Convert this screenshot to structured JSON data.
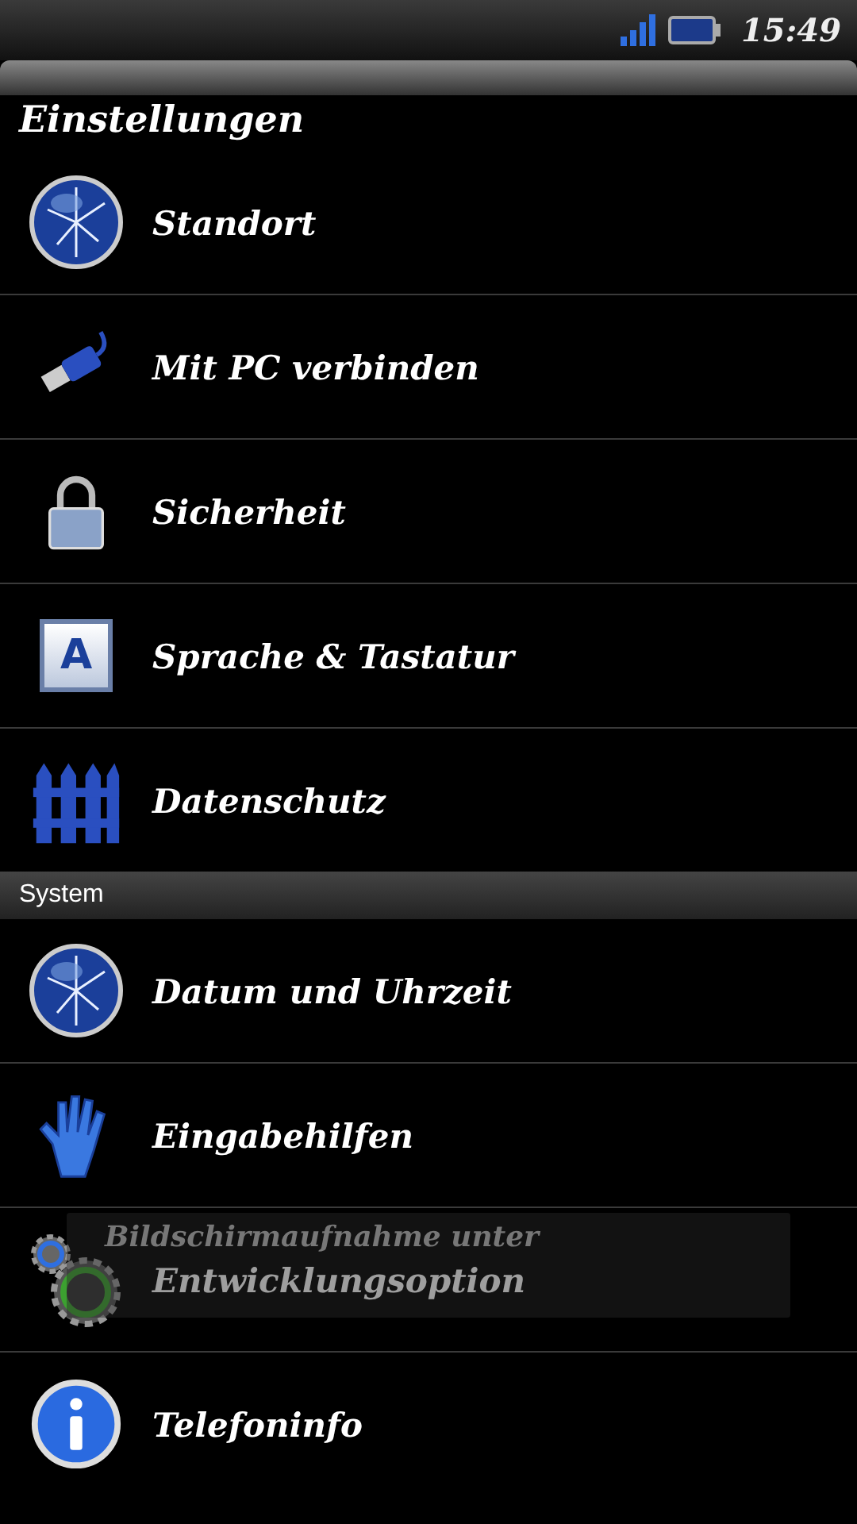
{
  "status_bar": {
    "time": "15:49"
  },
  "title": "Einstellungen",
  "groups": [
    {
      "items": [
        {
          "label": "Standort",
          "kind": "globe"
        },
        {
          "label": "Mit PC verbinden",
          "kind": "usb"
        },
        {
          "label": "Sicherheit",
          "kind": "lock"
        },
        {
          "label": "Sprache & Tastatur",
          "kind": "key",
          "key_letter": "A"
        },
        {
          "label": "Datenschutz",
          "kind": "fence"
        }
      ]
    },
    {
      "header": "System",
      "items": [
        {
          "label": "Datum und Uhrzeit",
          "kind": "globe"
        },
        {
          "label": "Eingabehilfen",
          "kind": "hand"
        },
        {
          "label": "Entwicklungsoption",
          "kind": "gears",
          "toast": "Bildschirmaufnahme unter"
        },
        {
          "label": "Telefoninfo",
          "kind": "info"
        }
      ]
    }
  ]
}
